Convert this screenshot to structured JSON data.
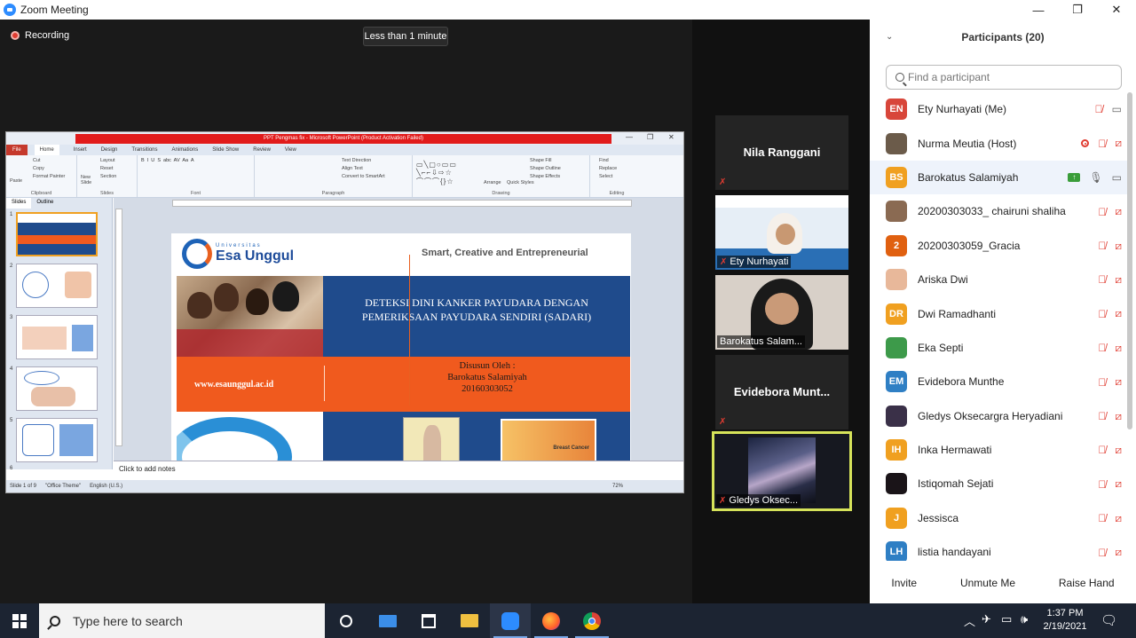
{
  "window": {
    "title": "Zoom Meeting",
    "min": "—",
    "max": "❐",
    "close": "✕"
  },
  "meeting": {
    "recording": "Recording",
    "timer": "Less than 1 minute"
  },
  "ppt": {
    "title_bar": "PPT Pengmas fix  -  Microsoft PowerPoint (Product Activation Failed)",
    "tabs": [
      "File",
      "Home",
      "Insert",
      "Design",
      "Transitions",
      "Animations",
      "Slide Show",
      "Review",
      "View"
    ],
    "ribbon": {
      "clipboard": {
        "label": "Clipboard",
        "paste": "Paste",
        "cut": "Cut",
        "copy": "Copy",
        "format_painter": "Format Painter"
      },
      "slides": {
        "label": "Slides",
        "new_slide": "New Slide",
        "layout": "Layout",
        "reset": "Reset",
        "section": "Section"
      },
      "font": {
        "label": "Font"
      },
      "paragraph": {
        "label": "Paragraph",
        "text_direction": "Text Direction",
        "align_text": "Align Text",
        "convert": "Convert to SmartArt"
      },
      "drawing": {
        "label": "Drawing",
        "arrange": "Arrange",
        "quick_styles": "Quick Styles",
        "shape_fill": "Shape Fill",
        "shape_outline": "Shape Outline",
        "shape_effects": "Shape Effects"
      },
      "editing": {
        "label": "Editing",
        "find": "Find",
        "replace": "Replace",
        "select": "Select"
      }
    },
    "panel_tabs": {
      "slides": "Slides",
      "outline": "Outline"
    },
    "thumb_numbers": [
      "1",
      "2",
      "3",
      "4",
      "5",
      "6"
    ],
    "notes_placeholder": "Click to add notes",
    "status": {
      "slide": "Slide 1 of 9",
      "theme": "\"Office Theme\"",
      "lang": "English (U.S.)",
      "zoom": "72%"
    },
    "slide": {
      "univ_small": "Universitas",
      "univ_name": "Esa Unggul",
      "tagline": "Smart, Creative and Entrepreneurial",
      "title_line1": "DETEKSI DINI KANKER PAYUDARA DENGAN",
      "title_line2": "PEMERIKSAAN PAYUDARA SENDIRI (SADARI)",
      "website": "www.esaunggul.ac.id",
      "by_label": "Disusun Oleh :",
      "author": "Barokatus Salamiyah",
      "nim": "20160303052",
      "img_label": "Breast Cancer"
    }
  },
  "gallery": [
    {
      "name": "Nila Ranggani",
      "type": "name"
    },
    {
      "name": "Ety Nurhayati",
      "type": "video"
    },
    {
      "name": "Barokatus Salam...",
      "type": "video"
    },
    {
      "name": "Evidebora  Munt...",
      "type": "name"
    },
    {
      "name": "Gledys Oksec...",
      "type": "video"
    }
  ],
  "participants": {
    "title": "Participants (20)",
    "search_placeholder": "Find a participant",
    "list": [
      {
        "initials": "EN",
        "name": "Ety Nurhayati (Me)",
        "color": "#d8463a",
        "mic": "muted",
        "video": "on"
      },
      {
        "initials": "",
        "name": "Nurma Meutia (Host)",
        "color": "#6b5b4a",
        "mic": "muted",
        "video": "off",
        "rec": true
      },
      {
        "initials": "BS",
        "name": "Barokatus Salamiyah",
        "color": "#f0a020",
        "mic": "on",
        "video": "on",
        "share": true
      },
      {
        "initials": "",
        "name": "20200303033_ chairuni shaliha",
        "color": "#8a6a52",
        "mic": "muted",
        "video": "off"
      },
      {
        "initials": "2",
        "name": "20200303059_Gracia",
        "color": "#e06010",
        "mic": "muted",
        "video": "off"
      },
      {
        "initials": "",
        "name": "Ariska Dwi",
        "color": "#e8b89a",
        "mic": "muted",
        "video": "off"
      },
      {
        "initials": "DR",
        "name": "Dwi Ramadhanti",
        "color": "#f0a020",
        "mic": "muted",
        "video": "off"
      },
      {
        "initials": "",
        "name": "Eka Septi",
        "color": "#3d9a4a",
        "mic": "muted",
        "video": "off"
      },
      {
        "initials": "EM",
        "name": "Evidebora Munthe",
        "color": "#2f7fc4",
        "mic": "muted",
        "video": "off"
      },
      {
        "initials": "",
        "name": "Gledys Oksecargra Heryadiani",
        "color": "#3a3048",
        "mic": "muted",
        "video": "off"
      },
      {
        "initials": "IH",
        "name": "Inka Hermawati",
        "color": "#f0a020",
        "mic": "muted",
        "video": "off"
      },
      {
        "initials": "",
        "name": "Istiqomah Sejati",
        "color": "#1a1418",
        "mic": "muted",
        "video": "off"
      },
      {
        "initials": "J",
        "name": "Jessisca",
        "color": "#f0a020",
        "mic": "muted",
        "video": "off"
      },
      {
        "initials": "LH",
        "name": "listia handayani",
        "color": "#2f7fc4",
        "mic": "muted",
        "video": "off"
      }
    ],
    "footer": {
      "invite": "Invite",
      "unmute": "Unmute Me",
      "raise": "Raise Hand"
    }
  },
  "taskbar": {
    "search": "Type here to search",
    "time": "1:37 PM",
    "date": "2/19/2021"
  }
}
